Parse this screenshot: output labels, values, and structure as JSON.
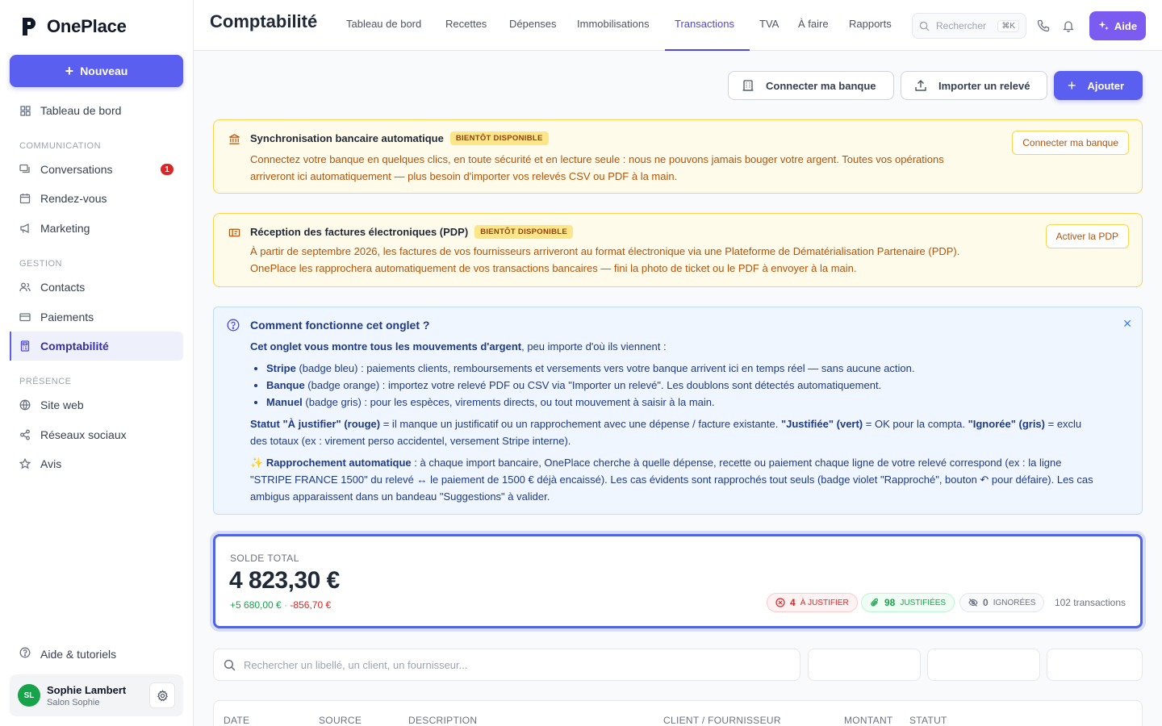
{
  "app": {
    "name": "OnePlace"
  },
  "sidebar": {
    "new_button": "Nouveau",
    "dashboard": "Tableau de bord",
    "sections": [
      {
        "label": "COMMUNICATION",
        "items": [
          {
            "label": "Conversations",
            "badge": "1"
          },
          {
            "label": "Rendez-vous"
          },
          {
            "label": "Marketing"
          }
        ]
      },
      {
        "label": "GESTION",
        "items": [
          {
            "label": "Contacts"
          },
          {
            "label": "Paiements"
          },
          {
            "label": "Comptabilité",
            "active": true
          }
        ]
      },
      {
        "label": "PRÉSENCE",
        "items": [
          {
            "label": "Site web"
          },
          {
            "label": "Réseaux sociaux"
          },
          {
            "label": "Avis"
          }
        ]
      }
    ],
    "help": "Aide & tutoriels",
    "user": {
      "initials": "SL",
      "name": "Sophie Lambert",
      "business": "Salon Sophie"
    }
  },
  "header": {
    "title": "Comptabilité",
    "tabs": [
      {
        "label": "Tableau de bord"
      },
      {
        "label": "Recettes"
      },
      {
        "label": "Dépenses"
      },
      {
        "label": "Immobilisations"
      },
      {
        "label": "Transactions",
        "active": true
      },
      {
        "label": "TVA"
      },
      {
        "label": "À faire"
      },
      {
        "label": "Rapports"
      }
    ],
    "search_placeholder": "Rechercher",
    "search_shortcut": "⌘K",
    "help_button": "Aide"
  },
  "actions": {
    "connect_bank": "Connecter ma banque",
    "import_statement": "Importer un relevé",
    "add": "Ajouter"
  },
  "banners": [
    {
      "title": "Synchronisation bancaire automatique",
      "badge": "BIENTÔT DISPONIBLE",
      "line1": "Connectez votre banque en quelques clics, en toute sécurité et en lecture seule : nous ne pouvons jamais bouger votre argent. Toutes vos opérations",
      "line2": "arriveront ici automatiquement — plus besoin d'importer vos relevés CSV ou PDF à la main.",
      "button": "Connecter ma banque"
    },
    {
      "title": "Réception des factures électroniques (PDP)",
      "badge": "BIENTÔT DISPONIBLE",
      "line1": "À partir de septembre 2026, les factures de vos fournisseurs arriveront au format électronique via une Plateforme de Dématérialisation Partenaire (PDP).",
      "line2": "OnePlace les rapprochera automatiquement de vos transactions bancaires — fini la photo de ticket ou le PDF à envoyer à la main.",
      "button": "Activer la PDP"
    }
  ],
  "info": {
    "title": "Comment fonctionne cet onglet ?",
    "intro_bold": "Cet onglet vous montre tous les mouvements d'argent",
    "intro_rest": ", peu importe d'où ils viennent :",
    "bullets": [
      {
        "bold": "Stripe",
        "text": " (badge bleu) : paiements clients, remboursements et versements vers votre banque arrivent ici en temps réel — sans aucune action."
      },
      {
        "bold": "Banque",
        "text": " (badge orange) : importez votre relevé PDF ou CSV via \"Importer un relevé\". Les doublons sont détectés automatiquement."
      },
      {
        "bold": "Manuel",
        "text": " (badge gris) : pour les espèces, virements directs, ou tout mouvement à saisir à la main."
      }
    ],
    "status_b1": "Statut \"À justifier\" (rouge)",
    "status_t1": " = il manque un justificatif ou un rapprochement avec une dépense / facture existante. ",
    "status_b2": "\"Justifiée\" (vert)",
    "status_t2": " = OK pour la compta. ",
    "status_b3": "\"Ignorée\" (gris)",
    "status_t3": " = exclu des totaux (ex : virement perso accidentel, versement Stripe interne).",
    "auto_emoji": "✨",
    "auto_bold": "Rapprochement automatique",
    "auto_text": " : à chaque import bancaire, OnePlace cherche à quelle dépense, recette ou paiement chaque ligne de votre relevé correspond (ex : la ligne \"STRIPE FRANCE 1500\" du relevé ↔ le paiement de 1500 € déjà encaissé). Les cas évidents sont rapprochés tout seuls (badge violet \"Rapproché\", bouton ↶ pour défaire). Les cas ambigus apparaissent dans un bandeau \"Suggestions\" à valider."
  },
  "balance": {
    "label": "SOLDE TOTAL",
    "value": "4 823,30 €",
    "income": "+5 680,00 €",
    "separator": "·",
    "expenses": "-856,70 €",
    "to_justify": {
      "count": "4",
      "label": "À JUSTIFIER"
    },
    "justified": {
      "count": "98",
      "label": "JUSTIFIÉES"
    },
    "ignored": {
      "count": "0",
      "label": "IGNORÉES"
    },
    "transactions": "102 transactions"
  },
  "filters": {
    "search_placeholder": "Rechercher un libellé, un client, un fournisseur..."
  },
  "table": {
    "columns": [
      "DATE",
      "SOURCE",
      "DESCRIPTION",
      "CLIENT / FOURNISSEUR",
      "MONTANT",
      "STATUT"
    ]
  },
  "colors": {
    "accent": "#5b5ff0",
    "warning_bg": "#fffbeb",
    "info_bg": "#eff6ff",
    "positive": "#16a34a",
    "negative": "#dc2626"
  }
}
